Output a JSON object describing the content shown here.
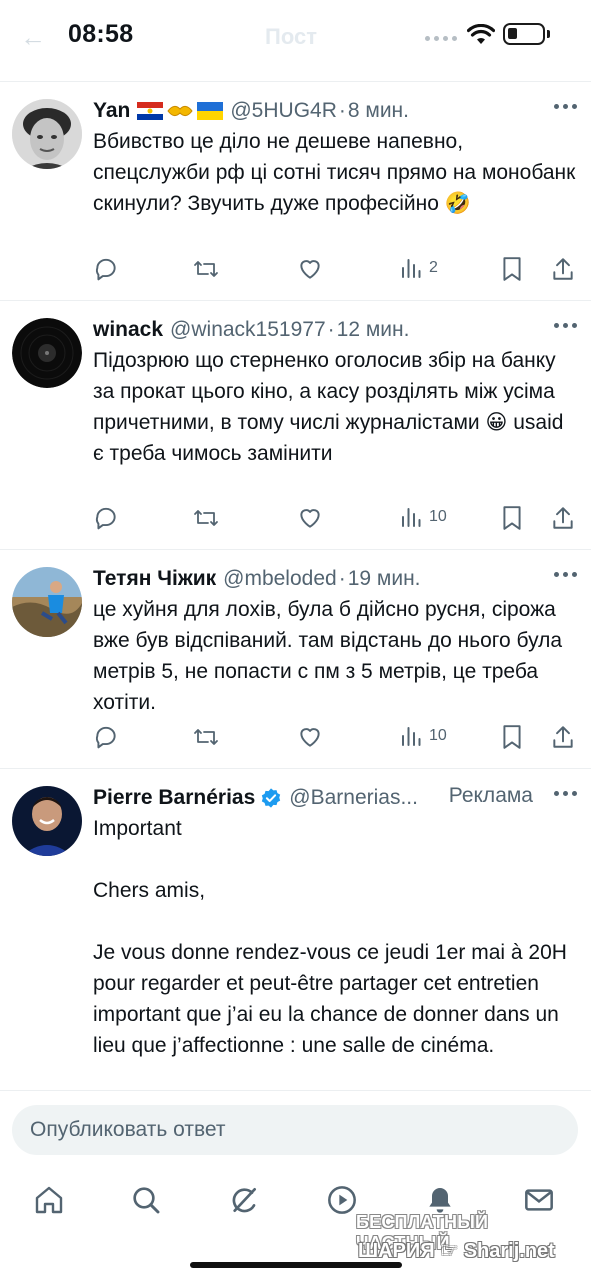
{
  "status_bar": {
    "time": "08:58",
    "faded_title": "Пост"
  },
  "tweets": [
    {
      "name": "Yan",
      "handle": "@5HUG4R",
      "time": "8 мин.",
      "text": "Вбивство це діло не дешеве напевно, спецслужби рф ці сотні тисяч прямо на монобанк скинули? Звучить дуже професійно",
      "emoji": "🤣",
      "views": "2"
    },
    {
      "name": "winack",
      "handle": "@winack151977",
      "time": "12 мин.",
      "text": "Підозрюю що стерненко оголосив збір на банку за прокат цього кіно, а касу розділять між усіма причетними, в тому числі журналістами",
      "emoji": "😀",
      "text_after": "usaid є треба чимось замінити",
      "views": "10"
    },
    {
      "name": "Тетян Чіжик",
      "handle": "@mbeloded",
      "time": "19 мин.",
      "text": "це хуйня для лохів, була б дійсно русня, сірожа вже був відспіваний. там відстань до нього була метрів 5, не попасти с пм з 5 метрів, це треба хотіти.",
      "views": "10"
    },
    {
      "name": "Pierre Barnérias",
      "handle": "@Barnerias...",
      "ad_label": "Реклама",
      "line1": "Important",
      "line2": "Chers amis,",
      "line3": "Je  vous donne rendez-vous ce jeudi 1er mai à 20H pour regarder et  peut-être partager cet entretien important que j’ai eu la chance de donner dans un lieu que j’affectionne : une salle de cinéma."
    }
  ],
  "reply": {
    "placeholder": "Опубликовать ответ"
  },
  "nav": [
    "home-icon",
    "search-icon",
    "grok-icon",
    "video-icon",
    "notifications-icon",
    "messages-icon"
  ],
  "watermark": {
    "line1": "БЕСПЛАТНЫЙ ЧАСТНЫЙ",
    "line2": "ШАРИЯ",
    "site": "Sharij.net"
  },
  "colors": {
    "text": "#0f1419",
    "muted": "#536471",
    "verified": "#1d9bf0",
    "divider": "#eceff1",
    "input_bg": "#eff3f4"
  }
}
